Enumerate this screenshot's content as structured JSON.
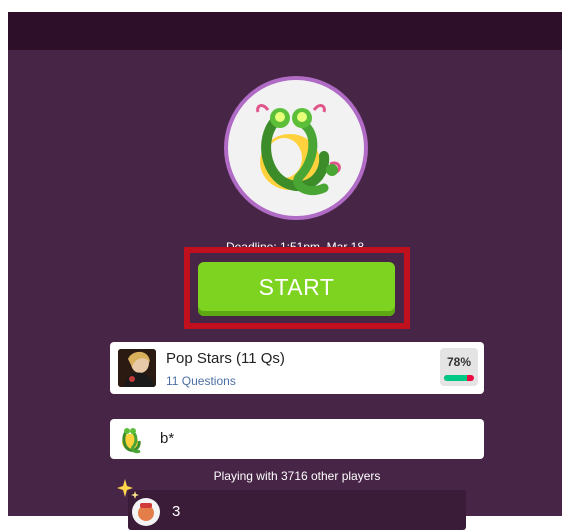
{
  "header": {
    "bar": ""
  },
  "game": {
    "deadline": "Deadline: 1:51pm, Mar 18",
    "start_label": "START",
    "players_text": "Playing with 3716 other players"
  },
  "quiz": {
    "title": "Pop Stars (11 Qs)",
    "subtitle": "11 Questions",
    "accuracy_label": "78%",
    "accuracy_value": 0.78
  },
  "player": {
    "name": "b*"
  },
  "leaderboard": {
    "rank": "3"
  },
  "colors": {
    "background": "#472546",
    "top_bar": "#2d0f2a",
    "start_button": "#7ed321",
    "highlight": "#c0101d",
    "accent_ring": "#b06bc4"
  },
  "icons": {
    "quiz_logo": "dragon-q-logo-icon",
    "quiz_thumb": "pop-star-thumbnail",
    "player_avatar": "dragon-q-avatar-icon",
    "rank_sparkle": "sparkle-icon"
  }
}
